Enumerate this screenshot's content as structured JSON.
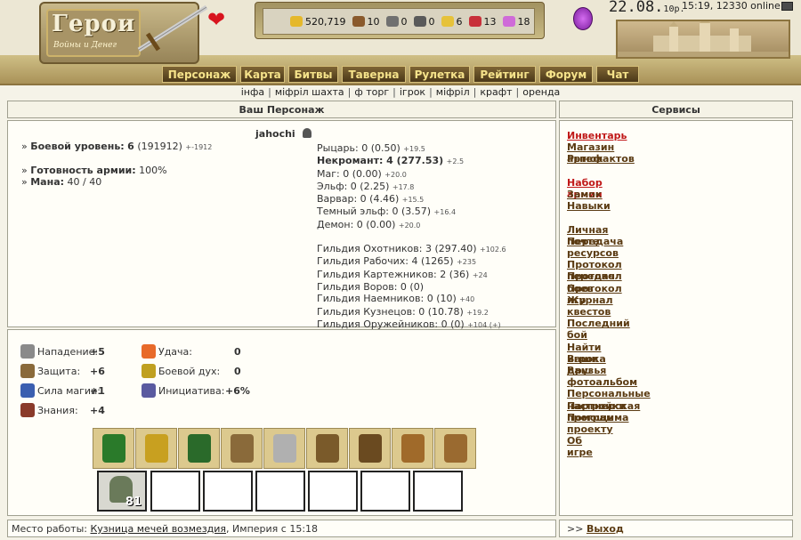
{
  "header": {
    "logo_title": "Герои",
    "logo_subtitle": "Войны и Денег",
    "resources": [
      {
        "icon": "gold-icon",
        "value": "520,719",
        "color": "#e5b82a"
      },
      {
        "icon": "wood-icon",
        "value": "10",
        "color": "#8a5a2c"
      },
      {
        "icon": "ore-icon",
        "value": "0",
        "color": "#707070"
      },
      {
        "icon": "mercury-icon",
        "value": "0",
        "color": "#5a5a5a"
      },
      {
        "icon": "sulfur-icon",
        "value": "6",
        "color": "#e6c23a"
      },
      {
        "icon": "crystal-icon",
        "value": "13",
        "color": "#c8303a"
      },
      {
        "icon": "gems-icon",
        "value": "18",
        "color": "#cf6bd8"
      }
    ],
    "date": "22.08.",
    "date_suffix": "10р.",
    "clock": "15:19, 12330 online"
  },
  "nav": [
    {
      "label": "Персонаж",
      "w": 84
    },
    {
      "label": "Карта",
      "w": 50
    },
    {
      "label": "Битвы",
      "w": 56
    },
    {
      "label": "Таверна",
      "w": 72
    },
    {
      "label": "Рулетка",
      "w": 68
    },
    {
      "label": "Рейтинг",
      "w": 70
    },
    {
      "label": "Форум",
      "w": 60
    },
    {
      "label": "Чат",
      "w": 48
    }
  ],
  "subnav": [
    "інфа",
    "міфріл шахта",
    "ф торг",
    "ігрок",
    "міфріл",
    "крафт",
    "оренда"
  ],
  "char_panel": {
    "title": "Ваш Персонаж"
  },
  "services_panel": {
    "title": "Сервисы"
  },
  "player": {
    "name": "jahochi",
    "combat_level_label": "Боевой уровень:",
    "combat_level": "6",
    "combat_exp": "(191912)",
    "combat_delta": "+-1912",
    "army_ready_label": "Готовность армии:",
    "army_ready": "100%",
    "mana_label": "Мана:",
    "mana": "40 / 40"
  },
  "factions": [
    {
      "text": "Рыцарь: 0 (0.50)",
      "delta": "+19.5"
    },
    {
      "text": "Некромант: 4 (277.53)",
      "delta": "+2.5",
      "bold": true
    },
    {
      "text": "Маг: 0 (0.00)",
      "delta": "+20.0"
    },
    {
      "text": "Эльф: 0 (2.25)",
      "delta": "+17.8"
    },
    {
      "text": "Варвар: 0 (4.46)",
      "delta": "+15.5"
    },
    {
      "text": "Темный эльф: 0 (3.57)",
      "delta": "+16.4"
    },
    {
      "text": "Демон: 0 (0.00)",
      "delta": "+20.0"
    }
  ],
  "guilds": [
    {
      "text": "Гильдия Охотников: 3 (297.40)",
      "delta": "+102.6"
    },
    {
      "text": "Гильдия Рабочих: 4 (1265)",
      "delta": "+235"
    },
    {
      "text": "Гильдия Картежников: 2 (36)",
      "delta": "+24"
    },
    {
      "text": "Гильдия Воров: 0 (0)",
      "delta": ""
    },
    {
      "text": "Гильдия Наемников: 0 (10)",
      "delta": "+40"
    },
    {
      "text": "Гильдия Кузнецов: 0 (10.78)",
      "delta": "+19.2"
    },
    {
      "text": "Гильдия Оружейников: 0 (0)",
      "delta": "+104 (+)"
    }
  ],
  "skills": [
    {
      "label": "Нападение:",
      "value": "+5",
      "icon": "sword-icon",
      "color": "#8a8a8a"
    },
    {
      "label": "Защита:",
      "value": "+6",
      "icon": "shield-icon",
      "color": "#8a6a3a"
    },
    {
      "label": "Сила магии:",
      "value": "+1",
      "icon": "wand-icon",
      "color": "#3b5fb0"
    },
    {
      "label": "Знания:",
      "value": "+4",
      "icon": "book-icon",
      "color": "#8a3a2a"
    },
    {
      "label": "Удача:",
      "value": "0",
      "icon": "rainbow-icon",
      "color": "#e86a2a"
    },
    {
      "label": "Боевой дух:",
      "value": "0",
      "icon": "wings-icon",
      "color": "#c0a020"
    },
    {
      "label": "Инициатива:",
      "value": "+6%",
      "icon": "potion-icon",
      "color": "#5a5aa0"
    }
  ],
  "equipment": [
    {
      "icon": "hat-icon",
      "color": "#2a7a2a"
    },
    {
      "icon": "amulet-icon",
      "color": "#c8a020"
    },
    {
      "icon": "armor-icon",
      "color": "#2a6a2a"
    },
    {
      "icon": "bow-icon",
      "color": "#8a6a3a"
    },
    {
      "icon": "saber-icon",
      "color": "#b0b0b0"
    },
    {
      "icon": "shield-item-icon",
      "color": "#7a5a2a"
    },
    {
      "icon": "boots-icon",
      "color": "#6a4a20"
    },
    {
      "icon": "gloves-icon",
      "color": "#a06a2a"
    },
    {
      "icon": "bracers-icon",
      "color": "#9a6a30"
    }
  ],
  "army": {
    "unit_icon": "zombie-icon",
    "count": "81",
    "empty_slots": 6
  },
  "services": [
    {
      "label": "Инвентарь",
      "red": true,
      "gap": false
    },
    {
      "label": "Магазин артефактов",
      "gap": false
    },
    {
      "label": "Рынок",
      "gap": false
    },
    {
      "label": "Набор армии",
      "red": true,
      "gap": true
    },
    {
      "label": "Замок",
      "gap": false
    },
    {
      "label": "Навыки",
      "gap": false
    },
    {
      "label": "Личная почта",
      "gap": true
    },
    {
      "label": "Передача ресурсов",
      "gap": false
    },
    {
      "label": "Протокол передач",
      "gap": true
    },
    {
      "label": "Протокол боев",
      "gap": false
    },
    {
      "label": "Протокол игр",
      "gap": false
    },
    {
      "label": "Журнал квестов",
      "gap": false
    },
    {
      "label": "Последний бой",
      "gap": true
    },
    {
      "label": "Найти игрока",
      "gap": true
    },
    {
      "label": "Ваши друзья",
      "gap": false
    },
    {
      "label": "Ваш фотоальбом",
      "gap": false
    },
    {
      "label": "Персональные настройки",
      "gap": true
    },
    {
      "label": "Партнерская программа",
      "gap": false
    },
    {
      "label": "Помощь проекту",
      "gap": false
    },
    {
      "label": "Об игре",
      "gap": true
    }
  ],
  "footer": {
    "workplace_label": "Место работы:",
    "workplace": "Кузница мечей возмездия",
    "workplace_tail": ", Империя с 15:18",
    "exit_prefix": ">>",
    "exit_label": "Выход"
  }
}
